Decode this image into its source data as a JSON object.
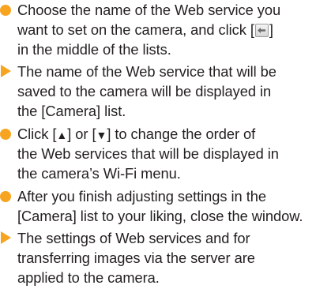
{
  "page": {
    "items": [
      {
        "kind": "step",
        "lines": [
          "Choose the name of the Web service you",
          "want to set on the camera, and click [",
          "in the middle of the lists."
        ],
        "inline_icon": "arrow-left-button-icon",
        "line2_suffix": "]"
      },
      {
        "kind": "result",
        "lines": [
          "The name of the Web service that will be",
          "saved to the camera will be displayed in",
          "the [Camera] list."
        ]
      },
      {
        "kind": "step",
        "lines": [
          "Click [",
          "] or [",
          "] to change the order of",
          "the Web services that will be displayed in",
          "the camera’s Wi-Fi menu."
        ],
        "symbols": [
          "▲",
          "▼"
        ]
      },
      {
        "kind": "step",
        "lines": [
          "After you finish adjusting settings in the",
          "[Camera] list to your liking, close the window."
        ]
      },
      {
        "kind": "result",
        "lines": [
          "The settings of Web services and for",
          "transferring images via the server are",
          "applied to the camera."
        ]
      }
    ],
    "colors": {
      "bullet": "#f7a521",
      "text": "#231f20"
    }
  }
}
